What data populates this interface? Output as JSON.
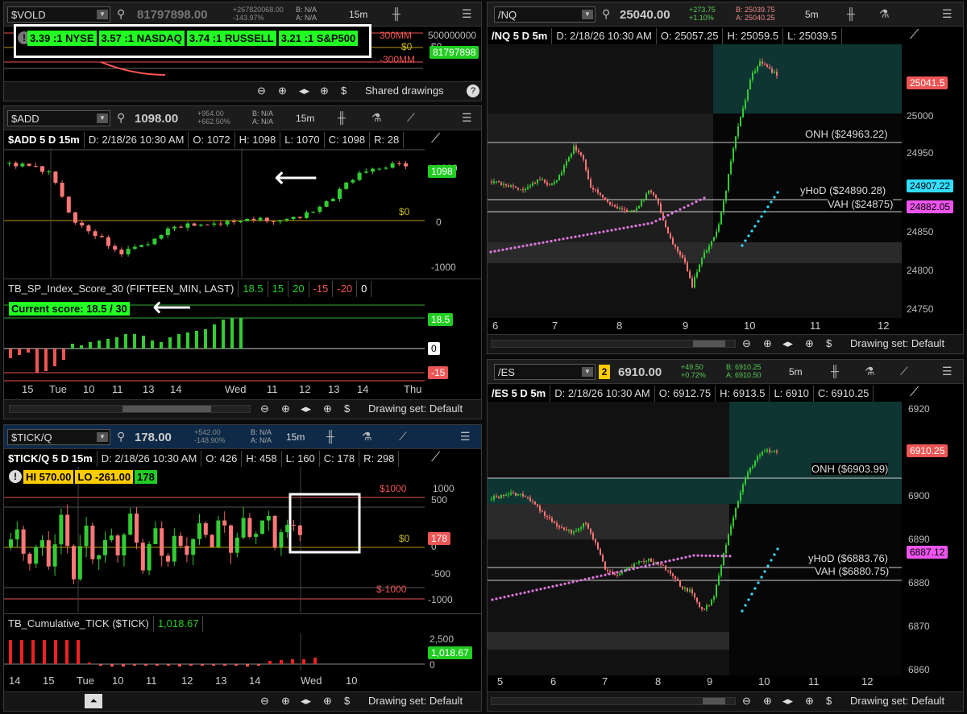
{
  "vold": {
    "symbol": "$VOLD",
    "last": "81797898.00",
    "change_lines": [
      "+267820068.00",
      "-143.97%"
    ],
    "bid": "B: N/A",
    "ask": "A: N/A",
    "timeframe": "15m",
    "ratios": [
      "3.39 :1 NYSE",
      "3.57 :1 NASDAQ",
      "3.74 :1 RUSSELL",
      "3.21 :1 S&P500"
    ],
    "axis_labels": [
      "500000000",
      "$0",
      "81797898"
    ],
    "levels": [
      "300MM",
      "$0",
      "-300MM"
    ],
    "footer_label": "Shared drawings"
  },
  "add": {
    "symbol": "$ADD",
    "last": "1098.00",
    "change_lines": [
      "+954.00",
      "+662.50%"
    ],
    "bid": "B: N/A",
    "ask": "A: N/A",
    "timeframe": "15m",
    "chart_info": {
      "title": "$ADD 5 D 15m",
      "date": "D: 2/18/26 10:30 AM",
      "open": "O: 1072",
      "high": "H: 1098",
      "low": "L: 1070",
      "close": "C: 1098",
      "range": "R: 28"
    },
    "axis": [
      "1000",
      "0",
      "-1000"
    ],
    "zero_label": "$0",
    "price_tag": "1098",
    "study": {
      "name": "TB_SP_Index_Score_30 (FIFTEEN_MIN, LAST)",
      "values": [
        "18.5",
        "15",
        "20",
        "-15",
        "-20",
        "0"
      ],
      "score_label": "Current score: 18.5 / 30",
      "tags": [
        "18.5",
        "0",
        "-15"
      ]
    },
    "x_labels": [
      "15",
      "Tue",
      "10",
      "11",
      "13",
      "14",
      "Wed",
      "11",
      "12",
      "13",
      "14",
      "Thu"
    ],
    "footer_label": "Drawing set: Default"
  },
  "tick": {
    "symbol": "$TICK/Q",
    "last": "178.00",
    "change_lines": [
      "+542.00",
      "-148.90%"
    ],
    "bid": "B: N/A",
    "ask": "A: N/A",
    "timeframe": "15m",
    "chart_info": {
      "title": "$TICK/Q 5 D 15m",
      "date": "D: 2/18/26 10:30 AM",
      "open": "O: 426",
      "high": "H: 458",
      "low": "L: 160",
      "close": "C: 178",
      "range": "R: 298"
    },
    "hi": "HI 570.00",
    "lo": "LO -261.00",
    "cur": "178",
    "axis": [
      "1000",
      "500",
      "0",
      "-500",
      "-1000"
    ],
    "levels": [
      "$1000",
      "$0",
      "$-1000"
    ],
    "price_tag": "178",
    "study": {
      "name": "TB_Cumulative_TICK ($TICK)",
      "value": "1,018.67",
      "axis": [
        "2,500",
        "0"
      ],
      "tag": "1,018.67"
    },
    "x_labels": [
      "14",
      "15",
      "Tue",
      "10",
      "11",
      "12",
      "13",
      "14",
      "Wed",
      "10"
    ],
    "footer_label": "Drawing set: Default"
  },
  "nq": {
    "symbol": "/NQ",
    "last": "25040.00",
    "change_lines": [
      "+273.75",
      "+1.10%"
    ],
    "bid": "B: 25039.75",
    "ask": "A: 25040.25",
    "timeframe": "5m",
    "chart_info": {
      "title": "/NQ 5 D 5m",
      "date": "D: 2/18/26 10:30 AM",
      "open": "O: 25057.25",
      "high": "H: 25059.5",
      "low": "L: 25039.5"
    },
    "axis": [
      "25050",
      "25000",
      "24950",
      "24900",
      "24850",
      "24800",
      "24750"
    ],
    "levels": [
      "ONH ($24963.22)",
      "yHoD ($24890.28)",
      "VAH ($24875)"
    ],
    "tags": [
      "25041.5",
      "24907.22",
      "24882.05"
    ],
    "x_labels": [
      "6",
      "7",
      "8",
      "9",
      "10",
      "11",
      "12"
    ],
    "footer_label": "Drawing set: Default"
  },
  "es": {
    "symbol": "/ES",
    "badge": "2",
    "last": "6910.00",
    "change_lines": [
      "+49.50",
      "+0.72%"
    ],
    "bid": "B: 6910.25",
    "ask": "A: 6910.50",
    "timeframe": "5m",
    "chart_info": {
      "title": "/ES 5 D 5m",
      "date": "D: 2/18/26 10:30 AM",
      "open": "O: 6912.75",
      "high": "H: 6913.5",
      "low": "L: 6910",
      "close": "C: 6910.25"
    },
    "axis": [
      "6920",
      "6910",
      "6900",
      "6890",
      "6880",
      "6870",
      "6860"
    ],
    "levels": [
      "ONH ($6903.99)",
      "yHoD ($6883.76)",
      "VAH ($6880.75)"
    ],
    "tags": [
      "6910.25",
      "6887.12"
    ],
    "x_labels": [
      "5",
      "6",
      "7",
      "8",
      "9",
      "10",
      "11",
      "12"
    ],
    "footer_label": "Drawing set: Default"
  }
}
